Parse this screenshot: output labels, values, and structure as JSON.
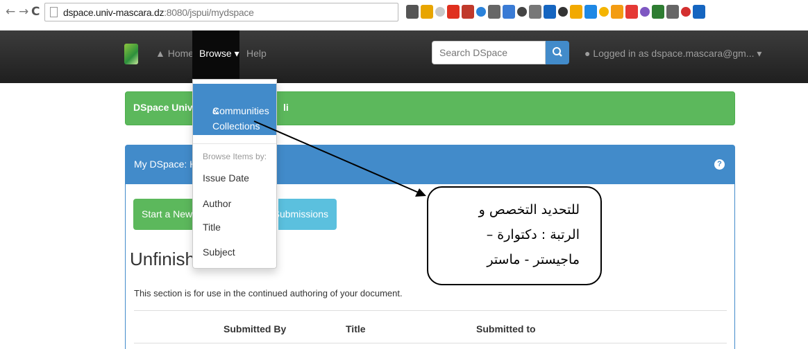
{
  "browser": {
    "back_icon": "←",
    "forward_icon": "→",
    "reload_icon": "C",
    "url_host": "dspace.univ-mascara.dz",
    "url_path": ":8080/jspui/mydspace",
    "extensions": [
      "#555",
      "#e8a500",
      "#c8c8c8",
      "#e0301e",
      "#c0392b",
      "#2a82da",
      "#666",
      "#3a7bd5",
      "#444",
      "#777",
      "#1565c0",
      "#333",
      "#f2a900",
      "#1e88e5",
      "#f4b400",
      "#f39c12",
      "#e53935",
      "#7e57c2",
      "#2e7d32",
      "#666",
      "#d32f2f",
      "#1565c0"
    ]
  },
  "navbar": {
    "home": "Home",
    "browse": "Browse ▾",
    "help": "Help",
    "search_placeholder": "Search DSpace",
    "login": "Logged in as dspace.mascara@gm... ▾"
  },
  "dropdown": {
    "communities": "Communities",
    "collections": "& Collections",
    "header": "Browse Items by:",
    "items": [
      "Issue Date",
      "Author",
      "Title",
      "Subject"
    ]
  },
  "banner": {
    "left": "DSpace Univers",
    "right": "li"
  },
  "panel": {
    "title": "My DSpace: HOU",
    "help": "?",
    "start_button": "Start a New Sub",
    "view_button": "ed Submissions",
    "heading": "Unfinished",
    "description": "This section is for use in the continued authoring of your document.",
    "columns": [
      "Submitted By",
      "Title",
      "Submitted to"
    ]
  },
  "annotation": {
    "lines": [
      "للتحديد التخصص و",
      "الرتبة : دكتوارة –",
      "ماجيستر - ماستر"
    ]
  }
}
